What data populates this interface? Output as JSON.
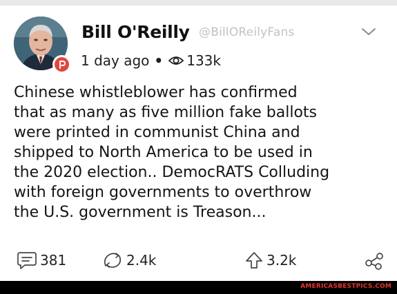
{
  "post": {
    "author_name": "Bill O'Reilly",
    "author_handle": "@BillOReilyFans",
    "time_ago": "1 day ago",
    "separator": "•",
    "views": "133k",
    "body_lines": [
      "Chinese whistleblower has confirmed",
      "that as many as five million fake ballots",
      "were printed in communist China and",
      "shipped to North America to be used in",
      "the 2020 election.. DemocRATS Colluding",
      "with foreign governments to overthrow",
      "the U.S. government is Treason..."
    ]
  },
  "actions": {
    "comments": "381",
    "echoes": "2.4k",
    "upvotes": "3.2k"
  },
  "footer": {
    "watermark": "AMERICASBESTPICS.COM"
  },
  "colors": {
    "badge": "#e2473e",
    "handle": "#c2c2c2",
    "watermark": "#e3362d"
  },
  "icons": {
    "badge": "parler-logo-icon",
    "menu": "chevron-down-icon",
    "views": "eye-icon",
    "comments": "comment-icon",
    "echoes": "echo-icon",
    "upvotes": "upvote-arrow-icon",
    "share": "share-icon"
  }
}
